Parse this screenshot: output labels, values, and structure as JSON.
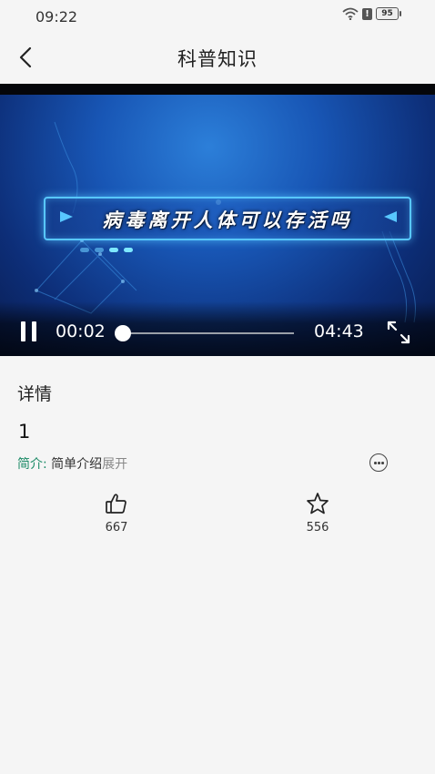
{
  "status_bar": {
    "time": "09:22",
    "battery": "95"
  },
  "nav": {
    "title": "科普知识"
  },
  "video": {
    "banner_text": "病毒离开人体可以存活吗",
    "current_time": "00:02",
    "total_time": "04:43",
    "progress": 0.007
  },
  "details": {
    "header": "详情",
    "title": "1",
    "intro_label": "简介:",
    "intro_text": "简单介绍",
    "expand_label": "展开"
  },
  "actions": {
    "like_count": "667",
    "favorite_count": "556"
  },
  "colors": {
    "accent_green": "#1b8a66",
    "background": "#f5f5f5"
  }
}
